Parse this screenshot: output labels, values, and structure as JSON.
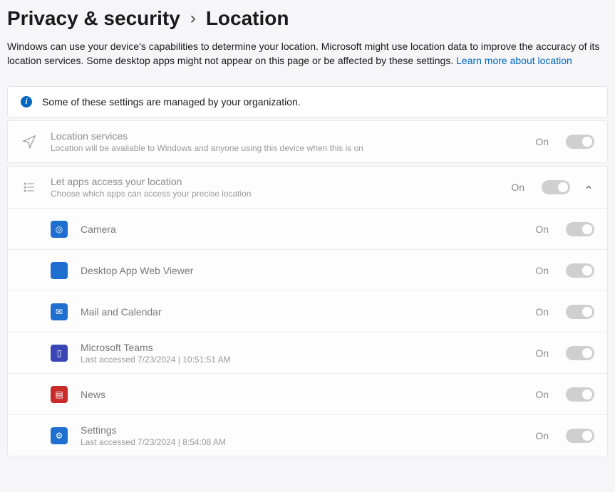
{
  "breadcrumb": {
    "parent": "Privacy & security",
    "current": "Location"
  },
  "description": {
    "text": "Windows can use your device's capabilities to determine your location. Microsoft might use location data to improve the accuracy of its location services. Some desktop apps might not appear on this page or be affected by these settings.  ",
    "link": "Learn more about location"
  },
  "banner": {
    "text": "Some of these settings are managed by your organization."
  },
  "location_services": {
    "title": "Location services",
    "subtitle": "Location will be available to Windows and anyone using this device when this is on",
    "state": "On"
  },
  "apps_access": {
    "title": "Let apps access your location",
    "subtitle": "Choose which apps can access your precise location",
    "state": "On"
  },
  "apps": [
    {
      "name": "Camera",
      "sub": "",
      "state": "On",
      "icon_bg": "#1f6fd0",
      "glyph": "◎"
    },
    {
      "name": "Desktop App Web Viewer",
      "sub": "",
      "state": "On",
      "icon_bg": "#1f6fd0",
      "glyph": ""
    },
    {
      "name": "Mail and Calendar",
      "sub": "",
      "state": "On",
      "icon_bg": "#1f6fd0",
      "glyph": "✉"
    },
    {
      "name": "Microsoft Teams",
      "sub": "Last accessed 7/23/2024  |  10:51:51 AM",
      "state": "On",
      "icon_bg": "#3a46b5",
      "glyph": "▯"
    },
    {
      "name": "News",
      "sub": "",
      "state": "On",
      "icon_bg": "#c92a2a",
      "glyph": "▤"
    },
    {
      "name": "Settings",
      "sub": "Last accessed 7/23/2024  |  8:54:08 AM",
      "state": "On",
      "icon_bg": "#1f6fd0",
      "glyph": "⚙"
    }
  ]
}
